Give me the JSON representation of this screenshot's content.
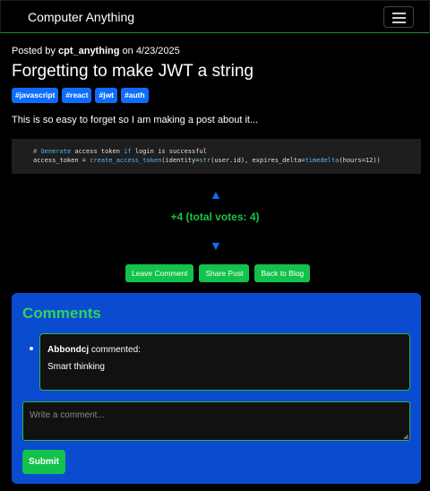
{
  "navbar": {
    "brand": "Computer Anything",
    "toggle_icon": "hamburger-menu-icon"
  },
  "post": {
    "posted_by_prefix": "Posted by",
    "author": "cpt_anything",
    "date_prefix": "on",
    "date": "4/23/2025",
    "title": "Forgetting to make JWT a string",
    "tags": [
      "#javascript",
      "#react",
      "#jwt",
      "#auth"
    ],
    "body": "This is so easy to forget so I am making a post about it...",
    "code": {
      "line1_comment_hash": "# ",
      "line1_kw_generate": "Generate",
      "line1_mid": " access token ",
      "line1_kw_if": "if",
      "line1_end": " login is successful",
      "line2_a": "access_token = ",
      "line2_fn": "create_access_token",
      "line2_b": "(identity=",
      "line2_kw_str": "str",
      "line2_c": "(user.id), expires_delta=",
      "line2_kw_td": "timedelta",
      "line2_d": "(hours=12))"
    }
  },
  "votes": {
    "up_icon": "▲",
    "down_icon": "▼",
    "summary": "+4 (total votes: 4)"
  },
  "actions": {
    "leave_comment": "Leave Comment",
    "share_post": "Share Post",
    "back_to_blog": "Back to Blog"
  },
  "comments": {
    "heading": "Comments",
    "items": [
      {
        "author": "Abbondcj",
        "verb": "commented:",
        "text": "Smart thinking"
      }
    ],
    "input_placeholder": "Write a comment...",
    "submit_label": "Submit"
  },
  "colors": {
    "accent_green": "#12c24a",
    "tag_blue": "#0d6efd",
    "comments_bg": "#0a4bcf"
  }
}
